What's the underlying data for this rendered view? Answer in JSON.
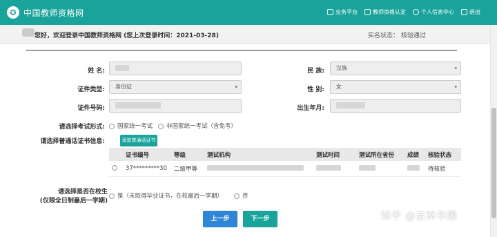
{
  "header": {
    "logo_icon": "seal-icon",
    "site_title": "中国教师资格网",
    "nav": [
      {
        "label": "业务平台",
        "icon": "platform-icon"
      },
      {
        "label": "教师资格认定",
        "icon": "monitor-icon"
      },
      {
        "label": "个人信息中心",
        "icon": "person-icon"
      },
      {
        "label": "退出",
        "icon": "logout-icon"
      }
    ]
  },
  "greeting": {
    "text": "您好，欢迎登录中国教师资格网 (您上次登录时间：2021-03-28)",
    "status": "实名状态：  核验通过"
  },
  "form": {
    "name_label": "姓  名:",
    "ethnicity_label": "民  族:",
    "ethnicity_value": "汉族",
    "id_type_label": "证件类型:",
    "id_type_value": "身份证",
    "gender_label": "性  别:",
    "gender_value": "女",
    "id_number_label": "证件号码:",
    "birth_label": "出生年月:",
    "exam_type_label": "请选择考试形式:",
    "exam_options": [
      "国家统一考试",
      "非国家统一考试（含免考）"
    ],
    "cert_label": "请选择普通话证书信息:",
    "add_cert_button": "添加普通话证书",
    "in_school_label_1": "请选择是否在校生",
    "in_school_label_2": "(仅限全日制最后一学期)",
    "in_school_options": [
      "是（未取得毕业证书，在校最后一学期）",
      "否"
    ]
  },
  "cert_table": {
    "columns": [
      "证书编号",
      "等级",
      "测试机构",
      "测试时间",
      "测试所在省份",
      "成绩",
      "核验状态"
    ],
    "rows": [
      {
        "number": "37*********30",
        "level": "二级甲等",
        "status": "待核验"
      }
    ]
  },
  "buttons": {
    "prev": "上一步",
    "next": "下一步",
    "prev_color": "#2f86d6",
    "next_color": "#1aa39a"
  },
  "watermark": "知乎 @吉林华图"
}
